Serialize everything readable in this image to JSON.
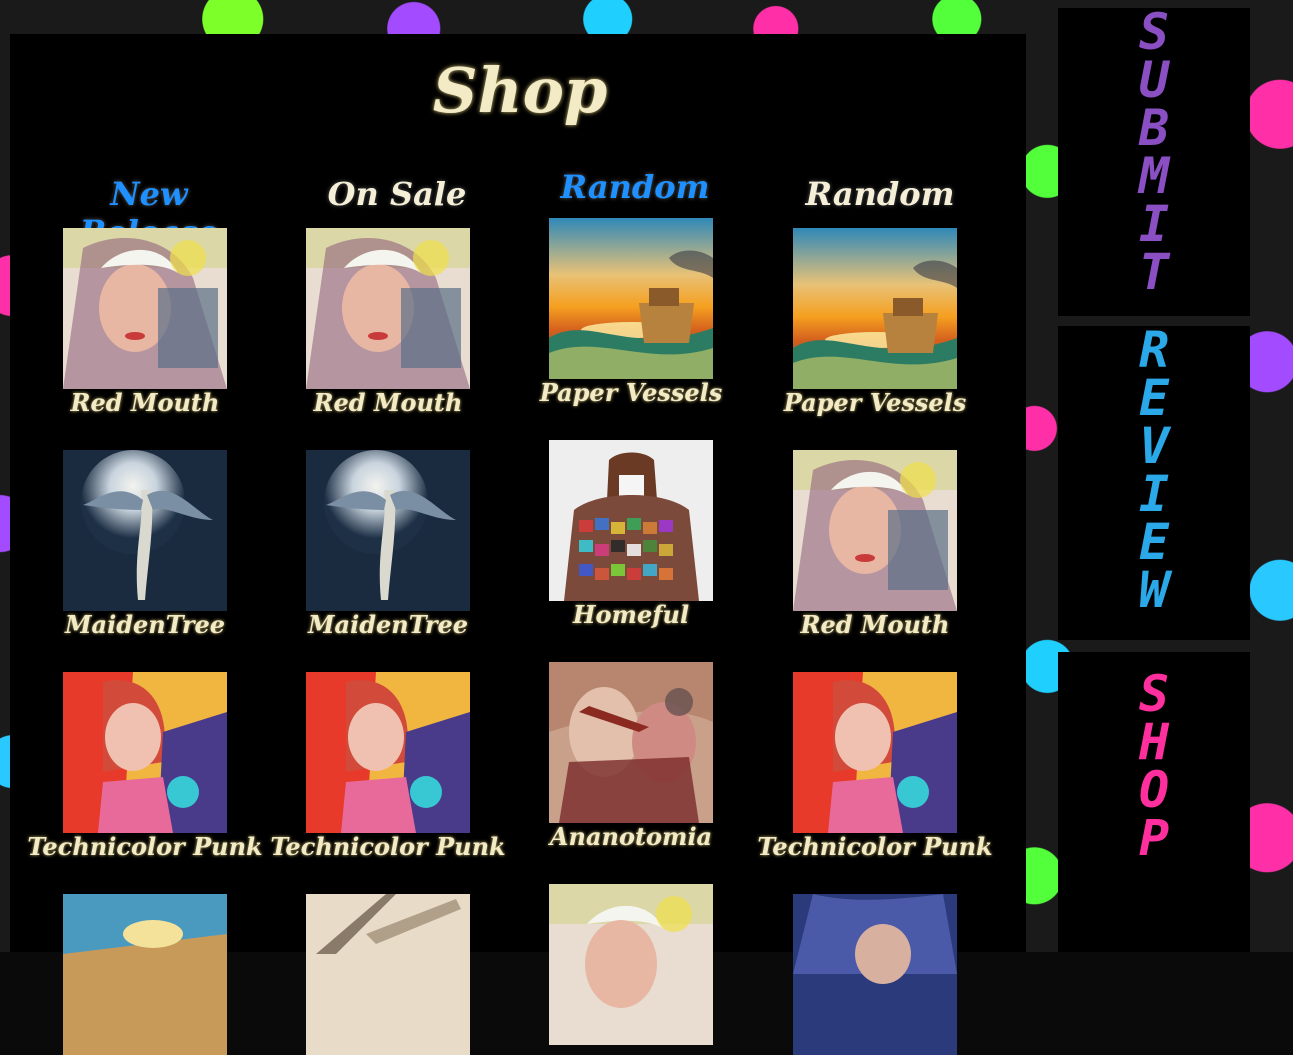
{
  "page": {
    "title": "Shop"
  },
  "columns": [
    {
      "header": "New Release",
      "color": "#1e90ff"
    },
    {
      "header": "On Sale",
      "color": "#f5efd8"
    },
    {
      "header": "Random",
      "color": "#1e90ff"
    },
    {
      "header": "Random",
      "color": "#f5efd8"
    }
  ],
  "items": [
    [
      "Red Mouth",
      "Red Mouth",
      "Paper Vessels",
      "Paper Vessels"
    ],
    [
      "MaidenTree",
      "MaidenTree",
      "Homeful",
      "Red Mouth"
    ],
    [
      "Technicolor Punk",
      "Technicolor Punk",
      "Ananotomia",
      "Technicolor Punk"
    ]
  ],
  "nav": {
    "submit": {
      "label": "SUBMIT",
      "color": "#8b4fc4"
    },
    "review": {
      "label": "REVIEW",
      "color": "#2aa8e8"
    },
    "shop": {
      "label": "SHOP",
      "color": "#ff2f9e"
    }
  }
}
